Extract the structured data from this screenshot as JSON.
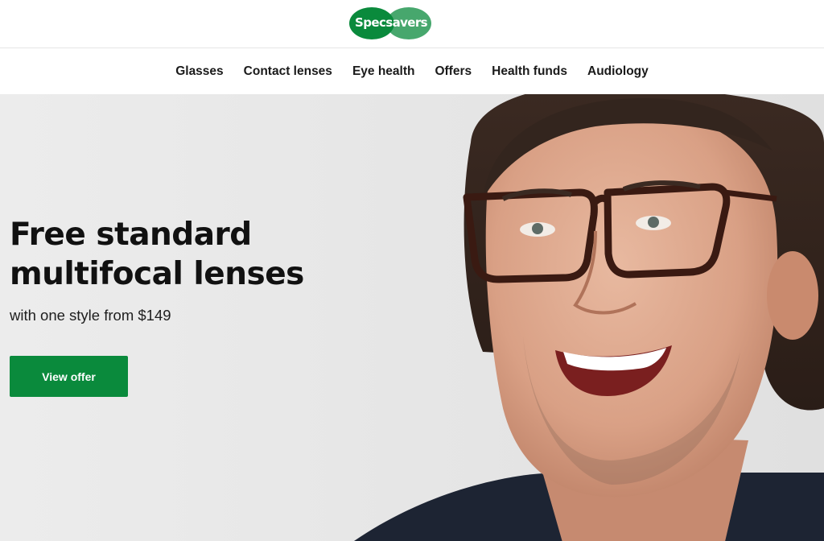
{
  "brand": {
    "logo_text": "Specsavers",
    "color": "#0a8a3c"
  },
  "nav": {
    "items": [
      {
        "label": "Glasses"
      },
      {
        "label": "Contact lenses"
      },
      {
        "label": "Eye health"
      },
      {
        "label": "Offers"
      },
      {
        "label": "Health funds"
      },
      {
        "label": "Audiology"
      }
    ]
  },
  "hero": {
    "headline": "Free standard multifocal lenses",
    "subline": "with one style from $149",
    "cta_label": "View offer",
    "image_subject": "smiling man wearing tortoiseshell glasses"
  }
}
